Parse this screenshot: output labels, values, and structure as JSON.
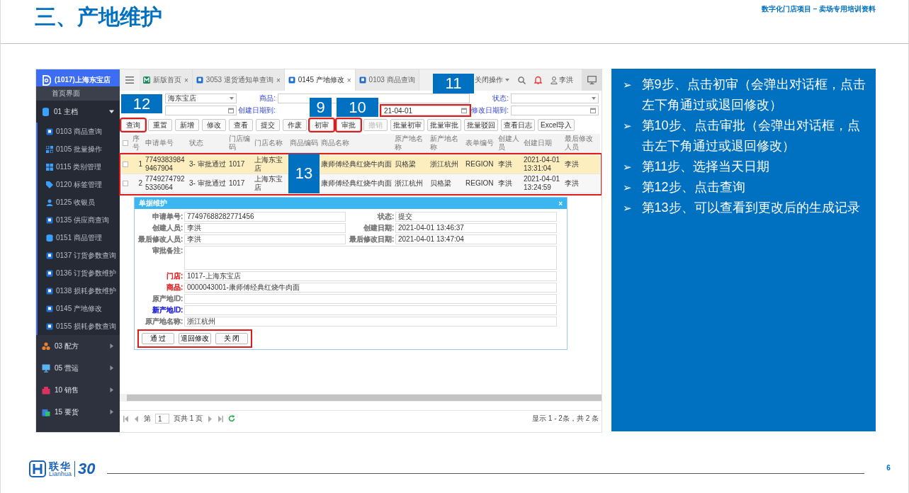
{
  "slide": {
    "title": "三、产地维护",
    "subtitle": "数字化门店项目 – 卖场专用培训资料",
    "page": "6"
  },
  "app": {
    "store": "(1017)上海东宝店",
    "sidebar": {
      "top_item": "首页界面",
      "groups": [
        {
          "label": "01 主档",
          "expanded": true,
          "children": [
            {
              "label": "0103 商品查询"
            },
            {
              "label": "0105 批量操作"
            },
            {
              "label": "0115 类别管理"
            },
            {
              "label": "0120 标签管理"
            },
            {
              "label": "0125 收银员"
            },
            {
              "label": "0135 供应商查询"
            },
            {
              "label": "0151 商品管理"
            },
            {
              "label": "0137 订货参数查询"
            },
            {
              "label": "0136 订货参数维护"
            },
            {
              "label": "0138 损耗参数维护"
            },
            {
              "label": "0145 产地修改"
            },
            {
              "label": "0155 损耗参数查询"
            }
          ]
        },
        {
          "label": "03 配方",
          "expanded": false
        },
        {
          "label": "05 营运",
          "expanded": false
        },
        {
          "label": "10 销售",
          "expanded": false
        },
        {
          "label": "15 要货",
          "expanded": false
        }
      ]
    },
    "tabs": [
      {
        "label": "新版首页",
        "selected": false,
        "close": "×"
      },
      {
        "label": "3053 退货通知单查询",
        "selected": false,
        "close": "×"
      },
      {
        "label": "0145 产地修改",
        "selected": true,
        "close": "×"
      },
      {
        "label": "0103 商品查询",
        "selected": false
      }
    ],
    "toolbar": {
      "menu": "关闭操作",
      "user": "李洪"
    },
    "filters": {
      "store": {
        "value": "海东宝店"
      },
      "product": {
        "label": "商品:"
      },
      "status": {
        "label": "状态:"
      },
      "created_to": {
        "label": "创建日期到:",
        "value": "21-04-01",
        "highlighted": true
      },
      "modified_to": {
        "label": "修改日期到:"
      }
    },
    "buttons": [
      {
        "label": "查询",
        "highlighted": true,
        "disabled": false
      },
      {
        "label": "重置",
        "highlighted": false,
        "disabled": false
      },
      {
        "label": "新增",
        "highlighted": false,
        "disabled": false
      },
      {
        "label": "修改",
        "highlighted": false,
        "disabled": false
      },
      {
        "label": "查看",
        "highlighted": false,
        "disabled": false
      },
      {
        "label": "提交",
        "highlighted": false,
        "disabled": false
      },
      {
        "label": "作废",
        "highlighted": false,
        "disabled": false
      },
      {
        "label": "初审",
        "highlighted": true,
        "disabled": false,
        "callout": "9"
      },
      {
        "label": "审批",
        "highlighted": true,
        "disabled": false,
        "callout": "10"
      },
      {
        "label": "撤销",
        "highlighted": false,
        "disabled": true
      },
      {
        "label": "批量初审",
        "highlighted": false,
        "disabled": false
      },
      {
        "label": "批量审批",
        "highlighted": false,
        "disabled": false
      },
      {
        "label": "批量驳回",
        "highlighted": false,
        "disabled": false
      },
      {
        "label": "查看日志",
        "highlighted": false,
        "disabled": false
      },
      {
        "label": "Excel导入",
        "highlighted": false,
        "disabled": false
      }
    ],
    "table": {
      "columns": [
        "序号",
        "申请单号",
        "状态",
        "门店编码",
        "门店名称",
        "商品编码",
        "商品名称",
        "原产地名称",
        "新产地名称",
        "表单编号",
        "创建人员",
        "创建日期",
        "最后修改人员"
      ],
      "highlighted": true,
      "callout": "13",
      "header_checked": false,
      "rows": [
        {
          "selected": true,
          "checked": false,
          "cells": [
            "1",
            "77493839849467904",
            "3- 审批通过",
            "1017",
            "上海东宝店",
            null,
            "康师傅经典红烧牛肉面",
            "贝格梁",
            "浙江杭州",
            "REGION",
            "李洪",
            "2021-04-01 13:31:04",
            "李洪"
          ]
        },
        {
          "selected": false,
          "checked": false,
          "cells": [
            "2",
            "77492747925336064",
            "3- 审批通过",
            "1017",
            "上海东宝店",
            null,
            "康师傅经典红烧牛肉面",
            "浙江杭州",
            "贝格梁",
            "REGION",
            "李洪",
            "2021-04-01 13:24:59",
            "李洪"
          ]
        }
      ]
    },
    "dialog": {
      "title": "单据维护",
      "close": "×",
      "fields": [
        {
          "kind": "half",
          "label": "申请单号:",
          "value": "77497688282771456",
          "color": "#777777"
        },
        {
          "kind": "half",
          "label": "状态:",
          "value": "提交",
          "color": "#777777"
        },
        {
          "kind": "half",
          "label": "创建人员:",
          "value": "李洪",
          "color": "#777777"
        },
        {
          "kind": "half",
          "label": "创建日期:",
          "value": "2021-04-01 13:46:37",
          "color": "#777777"
        },
        {
          "kind": "half",
          "label": "最后修改人员:",
          "value": "李洪",
          "color": "#777777"
        },
        {
          "kind": "half",
          "label": "最后修改日期:",
          "value": "2021-04-01 13:47:04",
          "color": "#777777"
        },
        {
          "kind": "area",
          "label": "审批备注:",
          "color": "#777777"
        },
        {
          "kind": "full",
          "label": "门店:",
          "value": "1017-上海东宝店",
          "color": "#e52222"
        },
        {
          "kind": "full",
          "label": "商品:",
          "value": "0000043001-康师傅经典红烧牛肉面",
          "color": "#e52222"
        },
        {
          "kind": "full",
          "label": "原产地ID:",
          "color": "#777777"
        },
        {
          "kind": "full",
          "label": "新产地ID:",
          "color": "#2222dd"
        },
        {
          "kind": "full",
          "label": "原产地名称:",
          "value": "浙江杭州",
          "color": "#777777"
        }
      ],
      "buttons": [
        {
          "label": "通 过"
        },
        {
          "label": "退回修改"
        },
        {
          "label": "关 闭"
        }
      ],
      "buttons_highlighted": true
    },
    "pager": {
      "before": "第",
      "page": "1",
      "after": "页共 1 页",
      "summary": "显示 1 - 2条，共 2 条"
    },
    "callouts": [
      {
        "text": "11"
      },
      {
        "text": "12"
      }
    ]
  },
  "panel": {
    "steps": [
      {
        "bullet": "➢",
        "text": "第9步、点击初审（会弹出对话框，点击左下角通过或退回修改）"
      },
      {
        "bullet": "➢",
        "text": "第10步、点击审批（会弹出对话框，点击左下角通过或退回修改）"
      },
      {
        "bullet": "➢",
        "text": "第11步、选择当天日期"
      },
      {
        "bullet": "➢",
        "text": "第12步、点击查询"
      },
      {
        "bullet": "➢",
        "text": "第13步、可以查看到更改后的生成记录"
      }
    ]
  },
  "footer": {
    "brand": "联华",
    "brand_sub": "Lianhua",
    "anniversary": "30"
  }
}
